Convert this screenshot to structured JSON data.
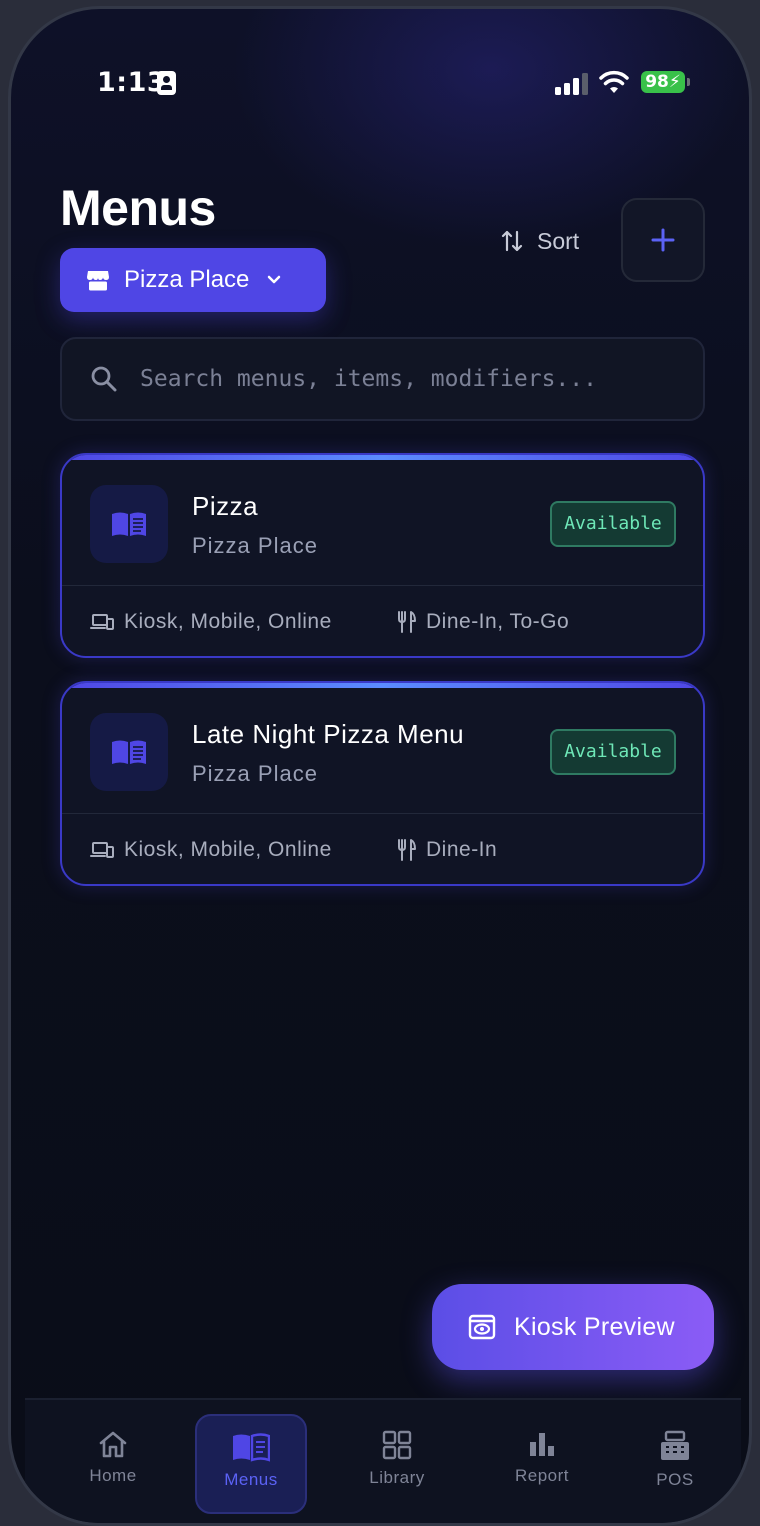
{
  "status_bar": {
    "time": "1:13",
    "battery": "98"
  },
  "header": {
    "title": "Menus",
    "location_label": "Pizza Place",
    "sort_label": "Sort"
  },
  "search": {
    "placeholder": "Search menus, items, modifiers..."
  },
  "menus": [
    {
      "name": "Pizza",
      "location": "Pizza Place",
      "status": "Available",
      "channels": "Kiosk, Mobile, Online",
      "order_types": "Dine-In, To-Go"
    },
    {
      "name": "Late Night Pizza Menu",
      "location": "Pizza Place",
      "status": "Available",
      "channels": "Kiosk, Mobile, Online",
      "order_types": "Dine-In"
    }
  ],
  "kiosk_preview": {
    "label": "Kiosk Preview"
  },
  "nav": {
    "items": [
      {
        "label": "Home",
        "icon": "home-icon"
      },
      {
        "label": "Menus",
        "icon": "book-icon",
        "active": true
      },
      {
        "label": "Library",
        "icon": "grid-icon"
      },
      {
        "label": "Report",
        "icon": "bar-chart-icon"
      },
      {
        "label": "POS",
        "icon": "register-icon"
      }
    ]
  },
  "colors": {
    "accent": "#4f46e5",
    "available_text": "#6ee7b7",
    "background": "#0b0e1c"
  }
}
